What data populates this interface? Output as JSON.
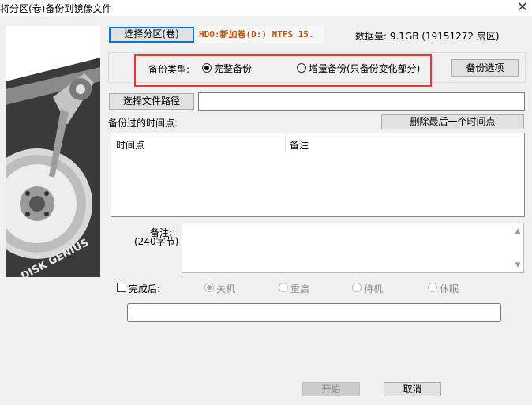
{
  "window": {
    "title": "将分区(卷)备份到镜像文件",
    "close_glyph": "✕"
  },
  "image_panel": {
    "logo_text": "DISK GENIUS"
  },
  "select_partition_button": "选择分区(卷)",
  "partition_name": "HDO:新加卷(D:) NTFS 15.",
  "data_size": "数据量: 9.1GB (19151272 扇区)",
  "backup_type": {
    "label": "备份类型:",
    "options": [
      {
        "label": "完整备份",
        "selected": true
      },
      {
        "label": "增量备份(只备份变化部分)",
        "selected": false
      }
    ]
  },
  "backup_options_button": "备份选项",
  "select_path_button": "选择文件路径",
  "file_path_value": "",
  "history": {
    "label": "备份过的时间点:",
    "delete_button": "删除最后一个时间点",
    "columns": [
      "时间点",
      "备注"
    ],
    "rows": []
  },
  "note": {
    "label": "备注:",
    "sublabel": "(240字节)",
    "value": ""
  },
  "after_completion": {
    "label": "完成后:",
    "checked": false,
    "options": [
      {
        "label": "关机",
        "selected": true
      },
      {
        "label": "重启",
        "selected": false
      },
      {
        "label": "待机",
        "selected": false
      },
      {
        "label": "休眠",
        "selected": false
      }
    ]
  },
  "progress_text": "",
  "start_button": "开始",
  "cancel_button": "取消",
  "colors": {
    "highlight_box": "#e53935",
    "partition_text": "#c0520f",
    "focus": "#0078d7"
  }
}
